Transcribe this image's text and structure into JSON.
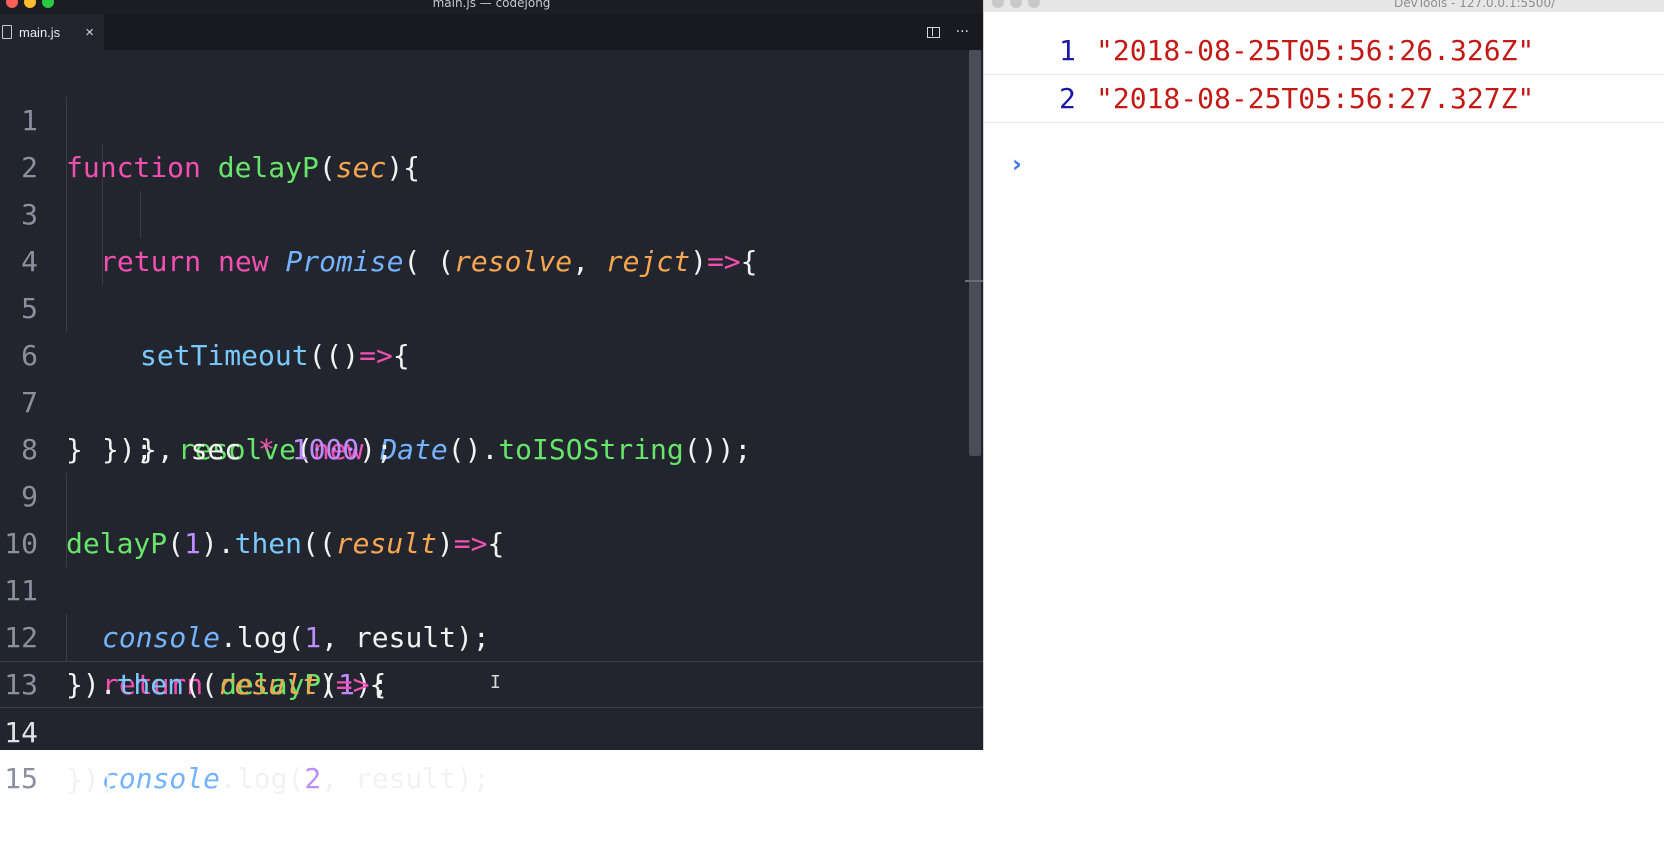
{
  "editor": {
    "window_title": "main.js — codejong",
    "tab": {
      "label": "main.js",
      "close": "×"
    },
    "actions": {
      "more": "···"
    },
    "lines": [
      {
        "n": "1"
      },
      {
        "n": "2"
      },
      {
        "n": "3"
      },
      {
        "n": "4"
      },
      {
        "n": "5"
      },
      {
        "n": "6"
      },
      {
        "n": "7"
      },
      {
        "n": "8"
      },
      {
        "n": "9"
      },
      {
        "n": "10"
      },
      {
        "n": "11"
      },
      {
        "n": "12"
      },
      {
        "n": "13"
      },
      {
        "n": "14"
      },
      {
        "n": "15"
      }
    ],
    "code": {
      "l1": [
        "function",
        " ",
        "delayP",
        "(",
        "sec",
        "){"
      ],
      "l2": [
        "return",
        " ",
        "new",
        " ",
        "Promise",
        "( (",
        "resolve",
        ", ",
        "rejct",
        ")",
        "=>",
        "{"
      ],
      "l3": [
        "setTimeout",
        "(()",
        "=>",
        "{"
      ],
      "l4": [
        "resolve",
        "(",
        "new",
        " ",
        "Date",
        "().",
        "toISOString",
        "());"
      ],
      "l5": [
        "}, sec ",
        "*",
        " ",
        "1000",
        ");"
      ],
      "l6": [
        "});"
      ],
      "l7": [
        "}"
      ],
      "l9": [
        "delayP",
        "(",
        "1",
        ").",
        "then",
        "((",
        "result",
        ")",
        "=>",
        "{"
      ],
      "l10": [
        "console",
        ".log(",
        "1",
        ", result);"
      ],
      "l11": [
        "return",
        " ",
        "delayP",
        "(",
        "1",
        ");"
      ],
      "l12": [
        "}).",
        "then",
        "((",
        "result",
        ")",
        "=>",
        "{"
      ],
      "l13": [
        "console",
        ".log(",
        "2",
        ", result);"
      ],
      "l14": [
        "});"
      ]
    },
    "active_line": "14"
  },
  "devtools": {
    "window_title": "DevTools - 127.0.0.1:5500/",
    "logs": [
      {
        "num": "1",
        "value": "\"2018-08-25T05:56:26.326Z\""
      },
      {
        "num": "2",
        "value": "\"2018-08-25T05:56:27.327Z\""
      }
    ],
    "prompt": "›"
  },
  "colors": {
    "editor_bg": "#23252e",
    "keyword": "#f34fb1",
    "function": "#67e56b",
    "class": "#74b3ff",
    "param": "#f6a550",
    "number": "#bc8dff",
    "console_number": "#1a1aa6",
    "console_string": "#c41a16"
  }
}
